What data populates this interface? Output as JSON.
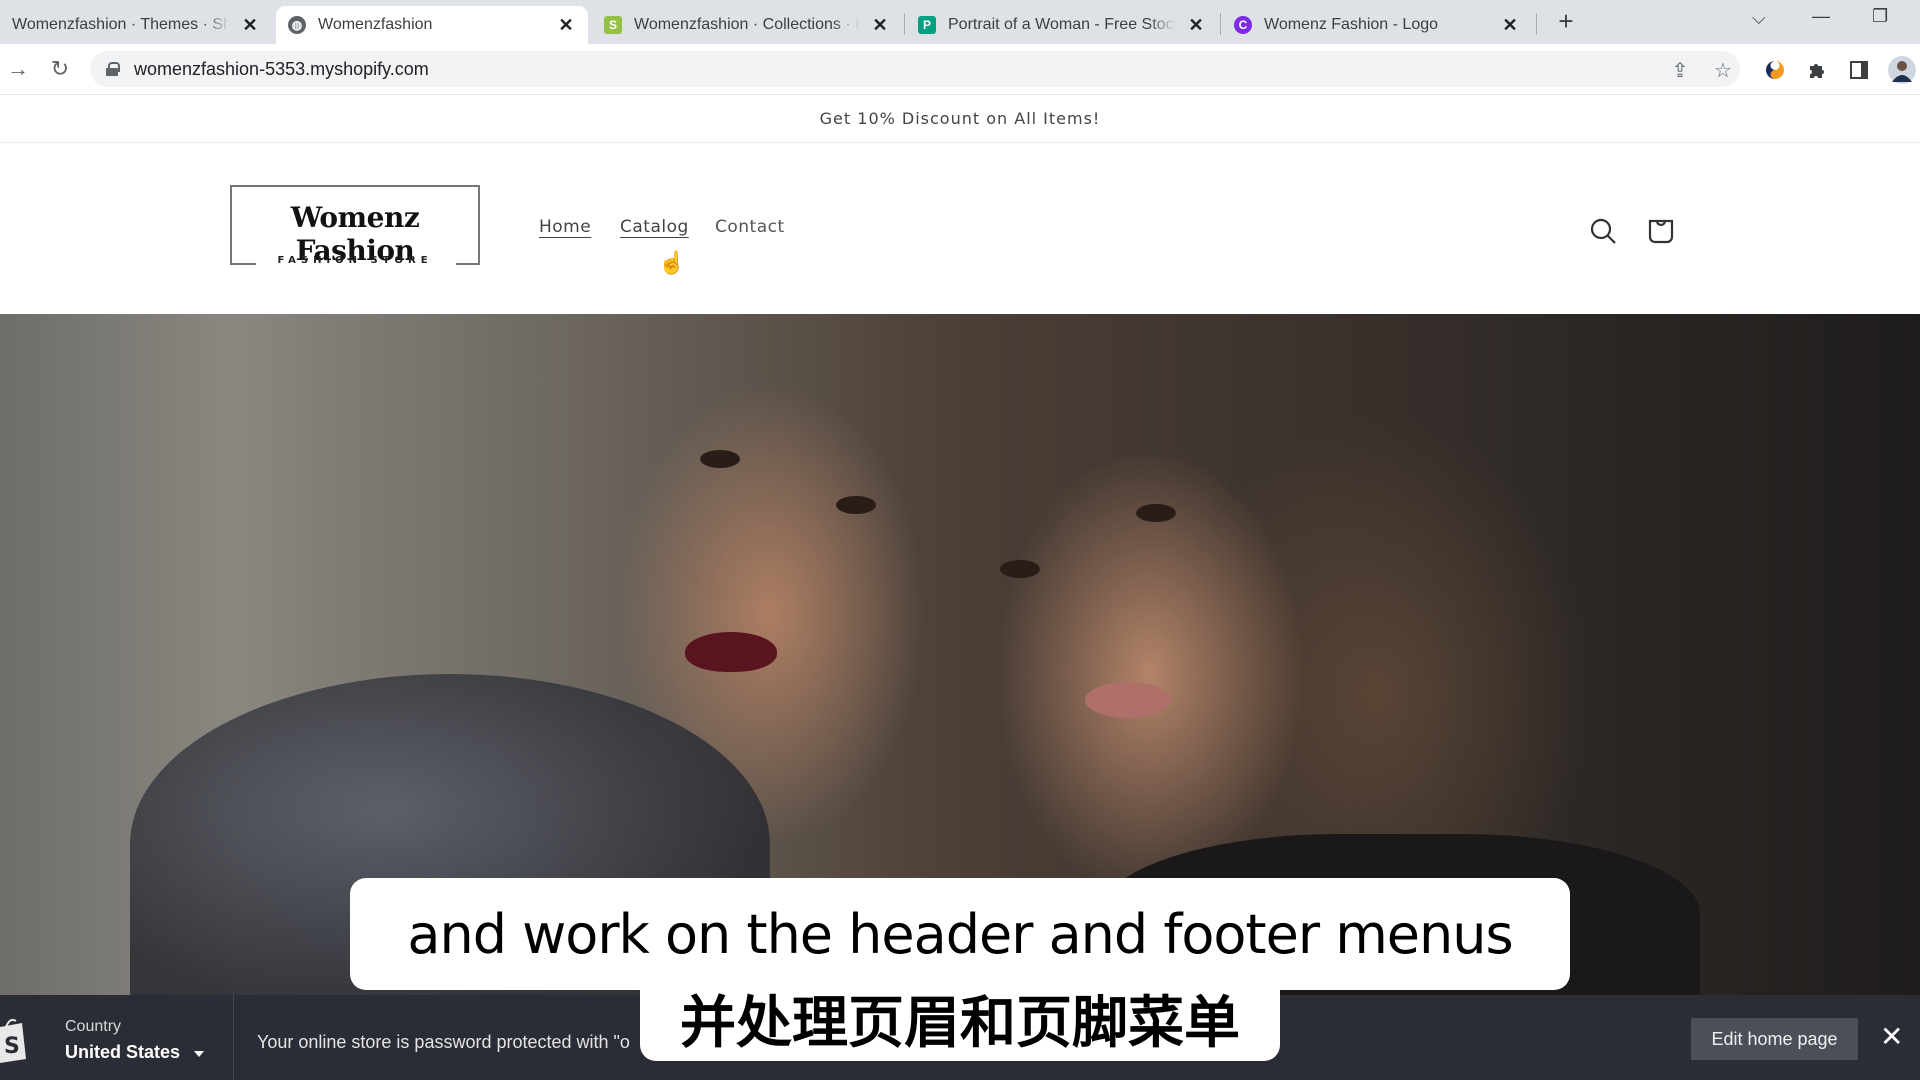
{
  "browser": {
    "tabs": [
      {
        "title": "Womenzfashion · Themes · Shop",
        "favicon": "shopify-icon",
        "active": false
      },
      {
        "title": "Womenzfashion",
        "favicon": "globe-icon",
        "active": true
      },
      {
        "title": "Womenzfashion · Collections · Ho",
        "favicon": "shopify-icon",
        "active": false
      },
      {
        "title": "Portrait of a Woman - Free Stock",
        "favicon": "pexels-icon",
        "active": false
      },
      {
        "title": "Womenz Fashion - Logo",
        "favicon": "canva-icon",
        "active": false
      }
    ],
    "new_tab_label": "+",
    "url": "womenzfashion-5353.myshopify.com",
    "favicon_colors": {
      "shopify": "#95bf47",
      "pexels": "#05a081",
      "canva": "#7d2ae8"
    }
  },
  "store": {
    "announcement": "Get 10% Discount on All Items!",
    "logo": {
      "title": "Womenz Fashion",
      "subtitle": "FASHION STORE"
    },
    "nav": [
      {
        "label": "Home",
        "active": true
      },
      {
        "label": "Catalog",
        "active": false,
        "hovered": true
      },
      {
        "label": "Contact",
        "active": false
      }
    ],
    "icons": {
      "search": "search-icon",
      "cart": "cart-icon"
    }
  },
  "subtitles": {
    "english": "and work on the header and footer menus",
    "chinese": "并处理页眉和页脚菜单"
  },
  "admin_bar": {
    "country_label": "Country",
    "country_value": "United States",
    "message": "Your online store is password protected with \"o",
    "edit_button": "Edit home page",
    "close_label": "✕"
  }
}
